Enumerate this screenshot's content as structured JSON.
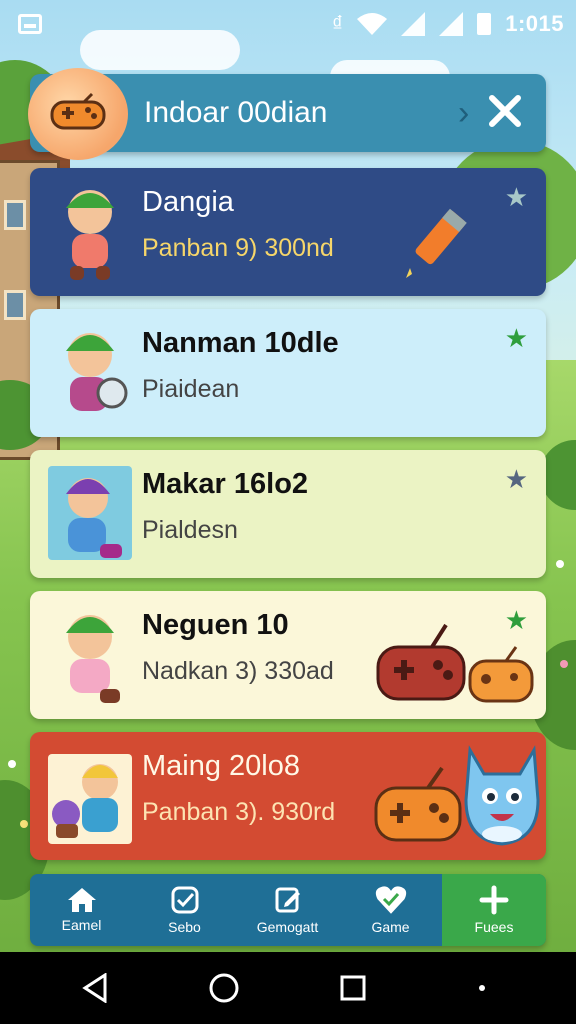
{
  "status_bar": {
    "time": "1:015",
    "bluetooth_icon": "bluetooth-icon",
    "wifi_icon": "wifi-icon",
    "signal_icon": "signal-icon",
    "battery_icon": "battery-icon"
  },
  "header": {
    "title": "Indoar 00dian",
    "logo_icon": "gamepad-icon",
    "chevron_icon": "chevron-right-icon",
    "close_icon": "close-icon"
  },
  "items": [
    {
      "title": "Dangia",
      "subtitle": "Panban 9) 300nd",
      "starred": false,
      "star_color": "#a8c8c8",
      "background": "#2f4b86"
    },
    {
      "title": "Nanman 10dle",
      "subtitle": "Piaidean",
      "starred": true,
      "star_color": "#2f9e3c",
      "background": "#cdeefa"
    },
    {
      "title": "Makar 16lo2",
      "subtitle": "Pialdesn",
      "starred": false,
      "star_color": "#556680",
      "background": "#ebf3c4"
    },
    {
      "title": "Neguen 10",
      "subtitle": "Nadkan 3) 330ad",
      "starred": true,
      "star_color": "#2f9e3c",
      "background": "#fbf7d9"
    },
    {
      "title": "Maing 20lo8",
      "subtitle": "Panban 3). 930rd",
      "starred": false,
      "star_color": "",
      "background": "#d34b32"
    }
  ],
  "tabs": [
    {
      "label": "Eamel",
      "icon": "home-icon",
      "active": false
    },
    {
      "label": "Sebo",
      "icon": "checkbox-icon",
      "active": false
    },
    {
      "label": "Gemogatt",
      "icon": "edit-icon",
      "active": false
    },
    {
      "label": "Game",
      "icon": "heart-check-icon",
      "active": false
    },
    {
      "label": "Fuees",
      "icon": "plus-icon",
      "active": true
    }
  ],
  "nav": {
    "back_icon": "back-icon",
    "home_icon": "home-circle-icon",
    "recents_icon": "recents-icon"
  },
  "colors": {
    "header": "#3a8fb0",
    "tabbar": "#1f6f96",
    "tab_active": "#3aa84a"
  }
}
